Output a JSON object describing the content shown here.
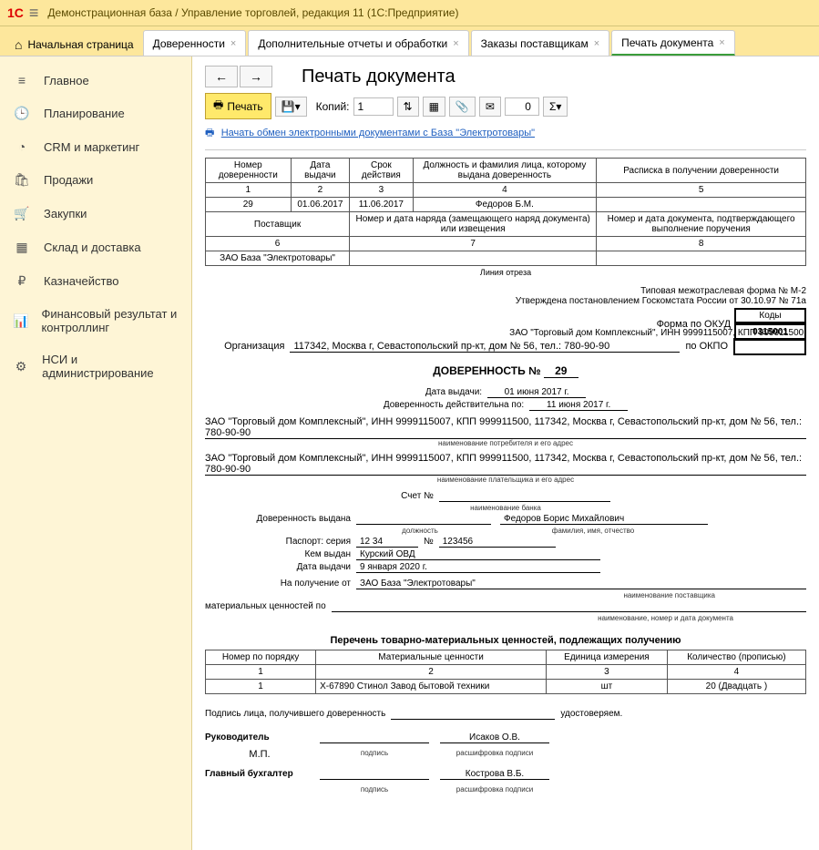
{
  "titlebar": {
    "text": "Демонстрационная база / Управление торговлей, редакция 11  (1С:Предприятие)"
  },
  "tabs": {
    "home": "Начальная страница",
    "items": [
      {
        "label": "Доверенности"
      },
      {
        "label": "Дополнительные отчеты и обработки"
      },
      {
        "label": "Заказы поставщикам"
      },
      {
        "label": "Печать документа",
        "active": true
      }
    ]
  },
  "sidebar": [
    {
      "icon": "≡",
      "label": "Главное"
    },
    {
      "icon": "🕒",
      "label": "Планирование"
    },
    {
      "icon": "◔",
      "label": "CRM и маркетинг"
    },
    {
      "icon": "🛍",
      "label": "Продажи"
    },
    {
      "icon": "🛒",
      "label": "Закупки"
    },
    {
      "icon": "▦",
      "label": "Склад и доставка"
    },
    {
      "icon": "₽",
      "label": "Казначейство"
    },
    {
      "icon": "📊",
      "label": "Финансовый результат и контроллинг"
    },
    {
      "icon": "⚙",
      "label": "НСИ и администрирование"
    }
  ],
  "page": {
    "title": "Печать документа"
  },
  "toolbar": {
    "print": "Печать",
    "copies_label": "Копий:",
    "copies_value": "1",
    "sum_display": "0"
  },
  "exchange_link": "Начать обмен электронными документами с База \"Электротовары\"",
  "top_table": {
    "headers": [
      "Номер доверенности",
      "Дата выдачи",
      "Срок действия",
      "Должность и фамилия лица, которому выдана доверенность",
      "Расписка в получении доверенности"
    ],
    "nums": [
      "1",
      "2",
      "3",
      "4",
      "5"
    ],
    "row": [
      "29",
      "01.06.2017",
      "11.06.2017",
      "Федоров Б.М.",
      ""
    ],
    "sub_headers": [
      "Поставщик",
      "Номер и дата наряда (замещающего наряд документа) или извещения",
      "Номер и дата документа, подтверждающего выполнение поручения"
    ],
    "sub_nums": [
      "6",
      "7",
      "8"
    ],
    "sub_row": [
      "ЗАО База \"Электротовары\"",
      "",
      ""
    ]
  },
  "cut_line": "Линия отреза",
  "form_meta": {
    "form_type": "Типовая межотраслевая форма № М-2",
    "approved": "Утверждена постановлением Госкомстата России от 30.10.97 № 71а",
    "codes_label": "Коды",
    "okud_label": "Форма по ОКУД",
    "okud": "0315001",
    "okpo_label": "по ОКПО",
    "org_line1": "ЗАО \"Торговый дом Комплексный\", ИНН 9999115007, КПП 999911500,",
    "org_label": "Организация",
    "org_line2": "117342, Москва г, Севастопольский пр-кт, дом № 56, тел.: 780-90-90"
  },
  "doc": {
    "title": "ДОВЕРЕННОСТЬ №",
    "number": "29",
    "issue_label": "Дата выдачи:",
    "issue_date": "01 июня 2017 г.",
    "valid_label": "Доверенность действительна по:",
    "valid_date": "11 июня 2017 г.",
    "consumer": "ЗАО \"Торговый дом Комплексный\", ИНН 9999115007, КПП 999911500, 117342, Москва г, Севастопольский пр-кт, дом № 56, тел.: 780-90-90",
    "consumer_cap": "наименование потребителя и его адрес",
    "payer": "ЗАО \"Торговый дом Комплексный\", ИНН 9999115007, КПП 999911500, 117342, Москва г, Севастопольский пр-кт, дом № 56, тел.: 780-90-90",
    "payer_cap": "наименование плательщика и его адрес",
    "account_label": "Счет №",
    "bank_cap": "наименование банка",
    "issued_label": "Доверенность выдана",
    "position_cap": "должность",
    "person": "Федоров Борис Михайлович",
    "fio_cap": "фамилия, имя, отчество",
    "passport_label": "Паспорт: серия",
    "passport_series": "12 34",
    "passport_num_label": "№",
    "passport_num": "123456",
    "issued_by_label": "Кем выдан",
    "issued_by": "Курский ОВД",
    "pass_date_label": "Дата выдачи",
    "pass_date": "9 января 2020 г.",
    "receive_label": "На получение от",
    "supplier": "ЗАО База \"Электротовары\"",
    "supplier_cap": "наименование поставщика",
    "mat_label": "материальных ценностей по",
    "mat_cap": "наименование, номер и дата документа"
  },
  "items_section": {
    "title": "Перечень товарно-материальных ценностей, подлежащих получению",
    "headers": [
      "Номер по порядку",
      "Материальные ценности",
      "Единица измерения",
      "Количество (прописью)"
    ],
    "nums": [
      "1",
      "2",
      "3",
      "4"
    ],
    "rows": [
      [
        "1",
        "X-67890 Стинол Завод бытовой техники",
        "шт",
        "20 (Двадцать )"
      ]
    ]
  },
  "signatures": {
    "sig_label": "Подпись лица, получившего доверенность",
    "confirm": "удостоверяем.",
    "head_label": "Руководитель",
    "head_name": "Исаков О.В.",
    "mp": "М.П.",
    "sub_sign": "подпись",
    "sub_decode": "расшифровка подписи",
    "acc_label": "Главный бухгалтер",
    "acc_name": "Кострова В.Б."
  }
}
